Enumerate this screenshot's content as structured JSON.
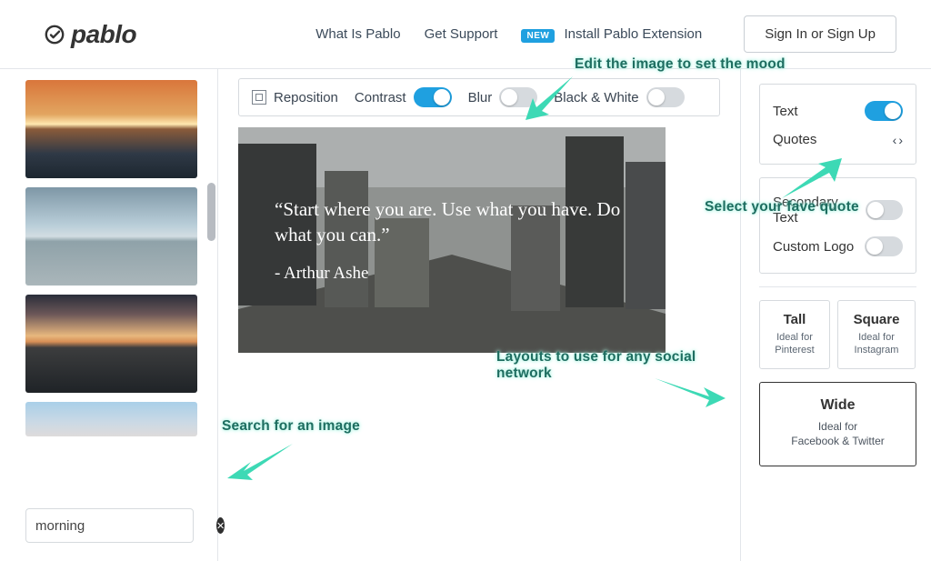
{
  "brand": "pablo",
  "header": {
    "what_is": "What Is Pablo",
    "support": "Get Support",
    "new_badge": "NEW",
    "install_ext": "Install Pablo Extension",
    "signin": "Sign In or Sign Up"
  },
  "search": {
    "value": "morning"
  },
  "toolbar": {
    "reposition": "Reposition",
    "contrast": "Contrast",
    "blur": "Blur",
    "bw": "Black & White",
    "contrast_on": true,
    "blur_on": false,
    "bw_on": false
  },
  "canvas": {
    "quote_text": "“Start where you are. Use what you have. Do what you can.”",
    "quote_author": "- Arthur Ashe"
  },
  "right": {
    "text_label": "Text",
    "quotes_label": "Quotes",
    "secondary_label": "Secondary Text",
    "logo_label": "Custom Logo",
    "text_on": true,
    "secondary_on": false,
    "logo_on": false
  },
  "layouts": {
    "tall": {
      "title": "Tall",
      "sub": "Ideal for Pinterest"
    },
    "square": {
      "title": "Square",
      "sub": "Ideal for Instagram"
    },
    "wide": {
      "title": "Wide",
      "sub": "Ideal for\nFacebook & Twitter"
    }
  },
  "annotations": {
    "mood": "Edit the image to set the mood",
    "quote": "Select your fave quote",
    "layouts": "Layouts to use for any social network",
    "search": "Search for an image"
  }
}
